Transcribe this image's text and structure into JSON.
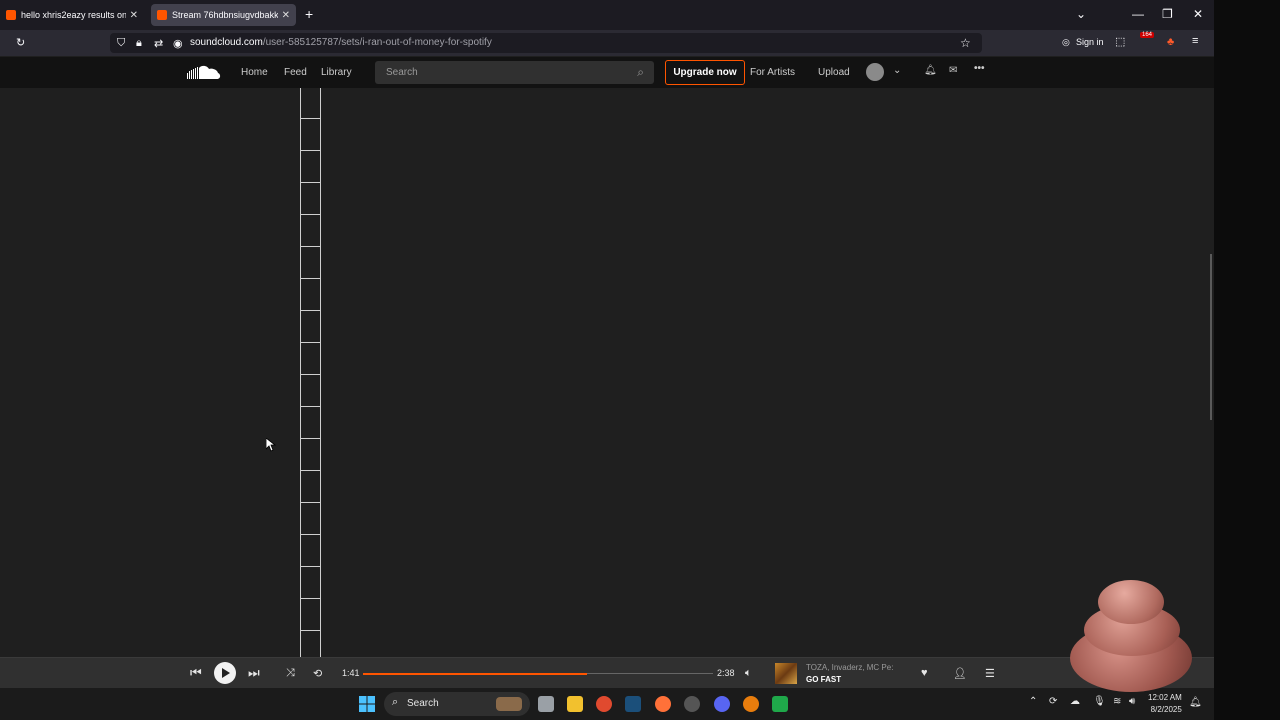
{
  "browser": {
    "tabs": [
      {
        "title": "hello xhris2eazy results on Sou"
      },
      {
        "title": "Stream 76hdbnsiugvdbakkuuel"
      }
    ],
    "url_domain": "soundcloud.com",
    "url_path": "/user-585125787/sets/i-ran-out-of-money-for-spotify",
    "sign_in": "Sign in",
    "notif_badge": "164"
  },
  "soundcloud": {
    "nav": {
      "home": "Home",
      "feed": "Feed",
      "library": "Library"
    },
    "search_placeholder": "Search",
    "upgrade": "Upgrade now",
    "for_artists": "For Artists",
    "upload": "Upload",
    "accent": "#ff5500"
  },
  "player": {
    "elapsed": "1:41",
    "duration": "2:38",
    "progress": 0.64,
    "artist": "TOZA, Invaderz, MC Pe:",
    "title": "GO FAST"
  },
  "taskbar": {
    "search": "Search",
    "time": "12:02 AM",
    "date": "8/2/2025"
  }
}
